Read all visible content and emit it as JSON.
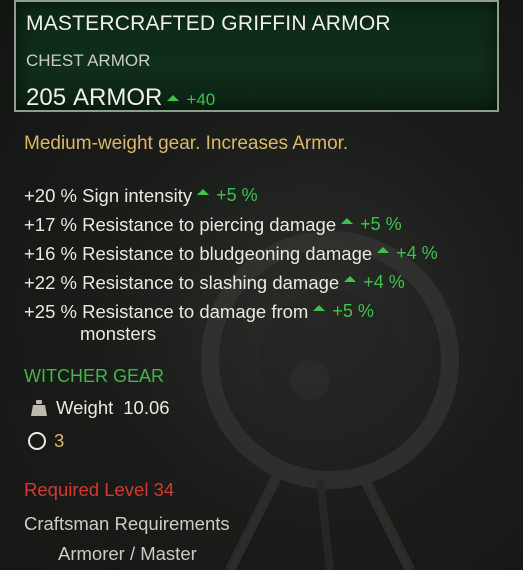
{
  "item": {
    "name": "MASTERCRAFTED GRIFFIN ARMOR",
    "type": "CHEST ARMOR",
    "armor_value": "205",
    "armor_label": "ARMOR",
    "armor_bonus": "+40"
  },
  "description": "Medium-weight gear. Increases Armor.",
  "stats": [
    {
      "text": "+20 % Sign intensity",
      "bonus": "+5 %"
    },
    {
      "text": "+17 % Resistance to piercing damage",
      "bonus": "+5 %"
    },
    {
      "text": "+16 % Resistance to bludgeoning damage",
      "bonus": "+4 %"
    },
    {
      "text": "+22 % Resistance to slashing damage",
      "bonus": "+4 %"
    },
    {
      "text": "+25 % Resistance to damage from",
      "bonus": "+5 %",
      "continuation": "monsters"
    }
  ],
  "gear_set": "WITCHER GEAR",
  "weight": {
    "label": "Weight",
    "value": "10.06",
    "icon": "weight-icon"
  },
  "slots": {
    "count": "3",
    "icon": "slot-circle-icon"
  },
  "required_level": "Required Level 34",
  "craftsman": {
    "label": "Craftsman Requirements",
    "value": "Armorer / Master"
  },
  "colors": {
    "header_bg": "#0f2e19",
    "header_border": "#8ca089",
    "bonus_green": "#3ec24a",
    "gold": "#d9b86a",
    "required_red": "#d23a2f",
    "gear_green": "#49b24f"
  }
}
